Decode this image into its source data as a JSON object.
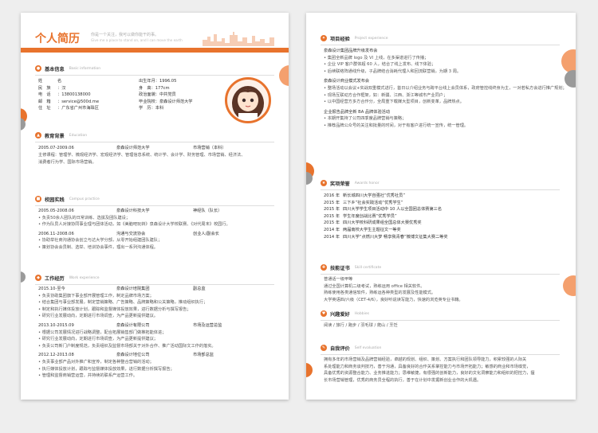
{
  "header": {
    "title": "个人简历",
    "motto1": "你是一个关注，我可以做你能干的事。",
    "motto2": "Give me a place to stand on, and I can move the earth"
  },
  "basic": {
    "title": "基本信息",
    "en": "Basic information",
    "left": [
      {
        "k": "姓",
        "v": "名"
      },
      {
        "k": "民　族",
        "v": "：汉"
      },
      {
        "k": "电　话",
        "v": "：13800138000"
      },
      {
        "k": "邮　箱",
        "v": "：service@500d.me"
      },
      {
        "k": "住　址",
        "v": "：广东省广州市海珠区"
      }
    ],
    "right": [
      "出生年月：1996.05",
      "身　高：177cm",
      "政治面貌：中共党员",
      "毕业院校：泉森设计师范大学",
      "学　历：本科"
    ]
  },
  "edu": {
    "title": "教育背景",
    "en": "Education",
    "date": "2005.07-2009.06",
    "school": "泉森设计师范大学",
    "major": "市场营销（本科）",
    "lines": [
      "主修课程：管理学、微观经济学、宏观经济学、管理信息系统、统计学、会计学、财务管理、市场营销、经济法、",
      "消费者行为学、国际市场营销。"
    ]
  },
  "campus": {
    "title": "校园实践",
    "en": "Campus practice",
    "items": [
      {
        "date": "2005.05-2008.06",
        "org": "泉森设计科技大学",
        "role": "神经队（队长）",
        "bullets": [
          "负责50余人团队的日常训练、选拔及团队建设；",
          "作为队员人对接协同事业理与团体活动，如《美脑吧玩转》泉森设计大学校联赛、《对代周末》校园行。"
        ]
      },
      {
        "date": "2006.11-2008.06",
        "org": "沟通与交流协会",
        "role": "创业人/副会长",
        "bullets": [
          "协助举社商沟通协会创立与达大学分部，从零开始组建团队建队；",
          "策划协会会员制、选举、培训协会事件，理出一系列沟通体程。"
        ]
      }
    ]
  },
  "work": {
    "title": "工作经历",
    "en": "Work experience",
    "items": [
      {
        "date": "2015.10-至今",
        "org": "泉森设计培院集团",
        "role": "副总监",
        "bullets": [
          "负责协助集团旗下事业部开展管理工作，制定品牌市场方案；",
          "结合集团与事业部发展，制定营销策略、广告策略、品牌策略和公关策略，推动组织执行；",
          "制定和执行媒体投放计划，跟踪和监督媒体投放效果，进行数据分析与撰写报告；",
          "研究行业发展动向，定期进行市场调查，为产品更新提供建议。"
        ]
      },
      {
        "date": "2013.10-2015.09",
        "org": "泉森设计有限公司",
        "role": "市场及运营总监",
        "bullets": [
          "根据公司发展情况进行战略调整，配合拓展销售部门做推拓能体进；",
          "研究行业发展动向，定期进行市场调查，为产品更新提供建议；",
          "负责公司新门户制度规范，负责组织及监督市场部关于对外合作、推广活动国际文工作的落实。"
        ]
      },
      {
        "date": "2012.12-2013.08",
        "org": "泉森设计地位公司",
        "role": "市场部总监",
        "bullets": [
          "负责事业部产品对外推广和宣传，制定各种整合营销的活动；",
          "执行媒体投放计划，跟踪与监督媒体投放效果，进行数据分析撰写报告；",
          "管理和监督商销营运营，并持续的联系产运营工作。"
        ]
      }
    ]
  },
  "project": {
    "title": "项目经验",
    "en": "Project experience",
    "groups": [
      {
        "head": "泉森设计集团品牌升级发布会",
        "bullets": [
          "集团全新品牌 logo 及 VI 上线，在多渠道进行了传播；",
          "企业 VIP 客户群体超 60 人，结合了线上发布、线下体验；",
          "后续联络阵通线升级，子品牌结合消耗代理人和回流联营销，为期 3 周。"
        ]
      },
      {
        "head": "泉森设计商业模式发布会",
        "bullets": [
          "整场活动以会议+实战双重模式进行，首日以介绍业务与跨平台线上会员体系，政府管控线终身为主，一对若私方会进行推广规划；",
          "现场互联动方合作框架，如：新疆、江西、浙江等城市产业同户；",
          "以中国经营方多方合作分，全局重下载媒大型项目，创新变革，品牌热点。"
        ]
      },
      {
        "head": "企业报告品牌全新 BA 品牌体验活动",
        "bullets": [
          "本期开集持了公司四季度品牌营销与策略；",
          "推荐品牌公众号的关注和批量的时间，对于有客户进行统一宣传，统一管理。"
        ]
      }
    ]
  },
  "awards": {
    "title": "奖项荣誉",
    "en": "Awards honor",
    "items": [
      {
        "year": "2016 年",
        "text": "新长城四川大学自强社“优秀社员”"
      },
      {
        "year": "2015 年",
        "text": "三下乡”社会实践活动“优秀学生”"
      },
      {
        "year": "2015 年",
        "text": "四川大学学生项目活动中 10 人以全国团总体赛第三名"
      },
      {
        "year": "2015 年",
        "text": "学生年度创战比赛“优秀学员”"
      },
      {
        "year": "2015 年",
        "text": "四川大学校科研成果组全国总体大赛优秀奖"
      },
      {
        "year": "2014 年",
        "text": "两届南校大学生主题征文一等奖"
      },
      {
        "year": "2014 年",
        "text": "四川大学“点燃川大梦 畅享我青春”微博文征集大赛二等奖"
      }
    ]
  },
  "skills": {
    "title": "技能证书",
    "en": "Skill certificate",
    "lines": [
      "普通话一级甲等",
      "通过全国计算机二级考试，熟练运用 office 相关软件。",
      "熟练使用各类通信软件，熟练运各种类型的发展及性能模式。",
      "大学英语四/六级（CET-4/6），良好听说读写能力，快速的浏览英专业书籍。"
    ]
  },
  "hobby": {
    "title": "兴趣爱好",
    "en": "Hobbies",
    "text": "阅读 / 旅行 / 跑步 / 羽毛球 / 爬山 / 烹饪"
  },
  "self": {
    "title": "自我评价",
    "en": "Self evaluation",
    "lines": [
      "拥有多年的市场营销及品牌营销经验，卓越的规划、组织、策划、方案执行和团队领导能力，积累较强的人际关",
      "系处理能力和商务谈判技巧，善于沟通，具备良好的合作关系掌控能力与市场开拓能力；敏感的商业和市场嗅觉，",
      "具备优秀的资源整合能力、业务推进能力；思维敏捷，有很强的创新能力，良好的文化洞察能力和组织的把控力，擅",
      "长市场营销管理，优秀的商务员全程的执行，善于在计划中发掘新创业合作的大机遇。"
    ]
  },
  "colors": {
    "accent": "#e8732d",
    "dark": "#4a4a4a",
    "gray": "#c9c9c9"
  }
}
